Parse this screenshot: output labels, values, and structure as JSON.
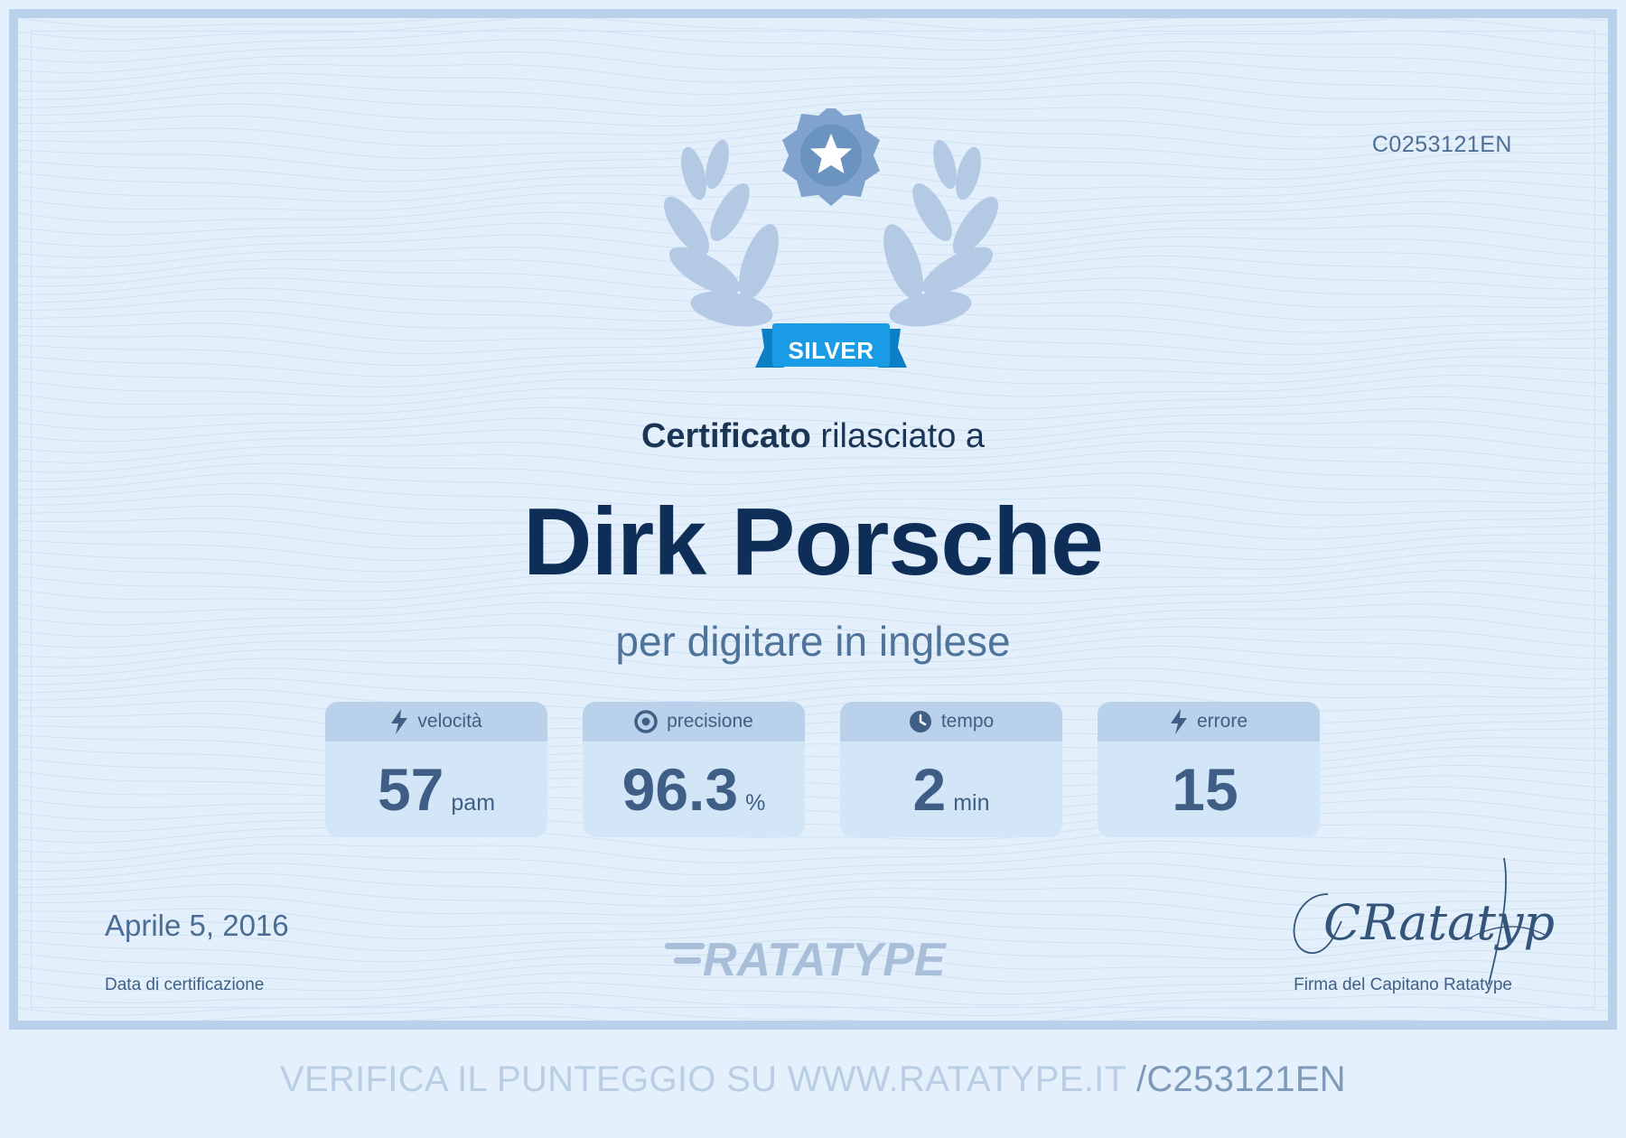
{
  "certificate": {
    "code": "C0253121EN",
    "badge_label": "SILVER",
    "issued_bold": "Certificato",
    "issued_rest": " rilasciato a",
    "recipient_name": "Dirk Porsche",
    "subtitle": "per digitare in inglese"
  },
  "stats": [
    {
      "label": "velocità",
      "value": "57",
      "unit": "pam",
      "icon": "lightning-icon"
    },
    {
      "label": "precisione",
      "value": "96.3",
      "unit": "%",
      "icon": "target-icon"
    },
    {
      "label": "tempo",
      "value": "2",
      "unit": "min",
      "icon": "clock-icon"
    },
    {
      "label": "errore",
      "value": "15",
      "unit": "",
      "icon": "lightning-icon"
    }
  ],
  "footer": {
    "date": "Aprile 5, 2016",
    "date_label": "Data di certificazione",
    "logo_text": "RATATYPE",
    "signature_text": "CRatatype",
    "signature_label": "Firma del Capitano Ratatype"
  },
  "verify": {
    "text": "VERIFICA IL PUNTEGGIO SU WWW.RATATYPE.IT ",
    "code": "/C253121EN"
  },
  "colors": {
    "background": "#e3f0fb",
    "border": "#b9d1ea",
    "name": "#0e2e57",
    "badge_ribbon": "#1a9be6",
    "medal": "#7fa3cc"
  }
}
